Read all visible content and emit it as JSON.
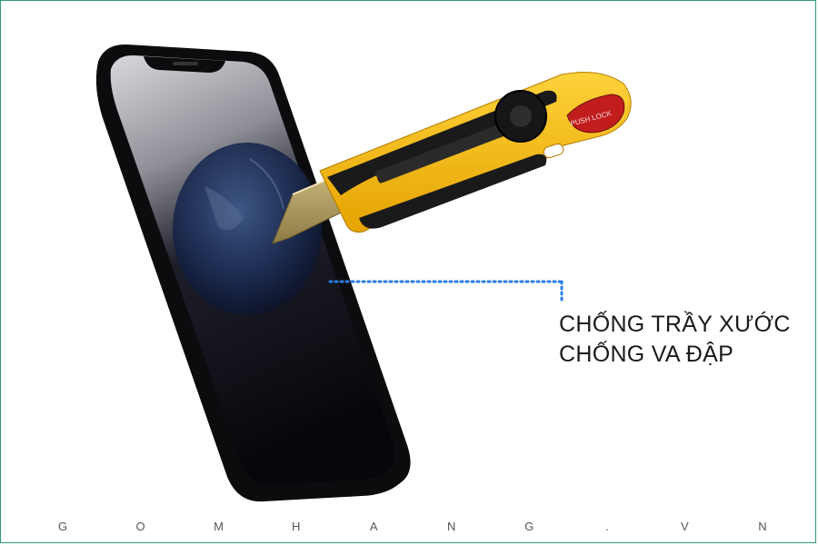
{
  "caption": {
    "line1": "CHỐNG TRẦY XƯỚC",
    "line2": "CHỐNG VA ĐẬP"
  },
  "knife_lock_label": "PUSH LOCK",
  "watermark": "GOMHANG.VN",
  "colors": {
    "frame": "#2f9a7e",
    "callout": "#2a7de1",
    "knife_yellow": "#f5b800",
    "phone_body": "#0c0c0f"
  }
}
